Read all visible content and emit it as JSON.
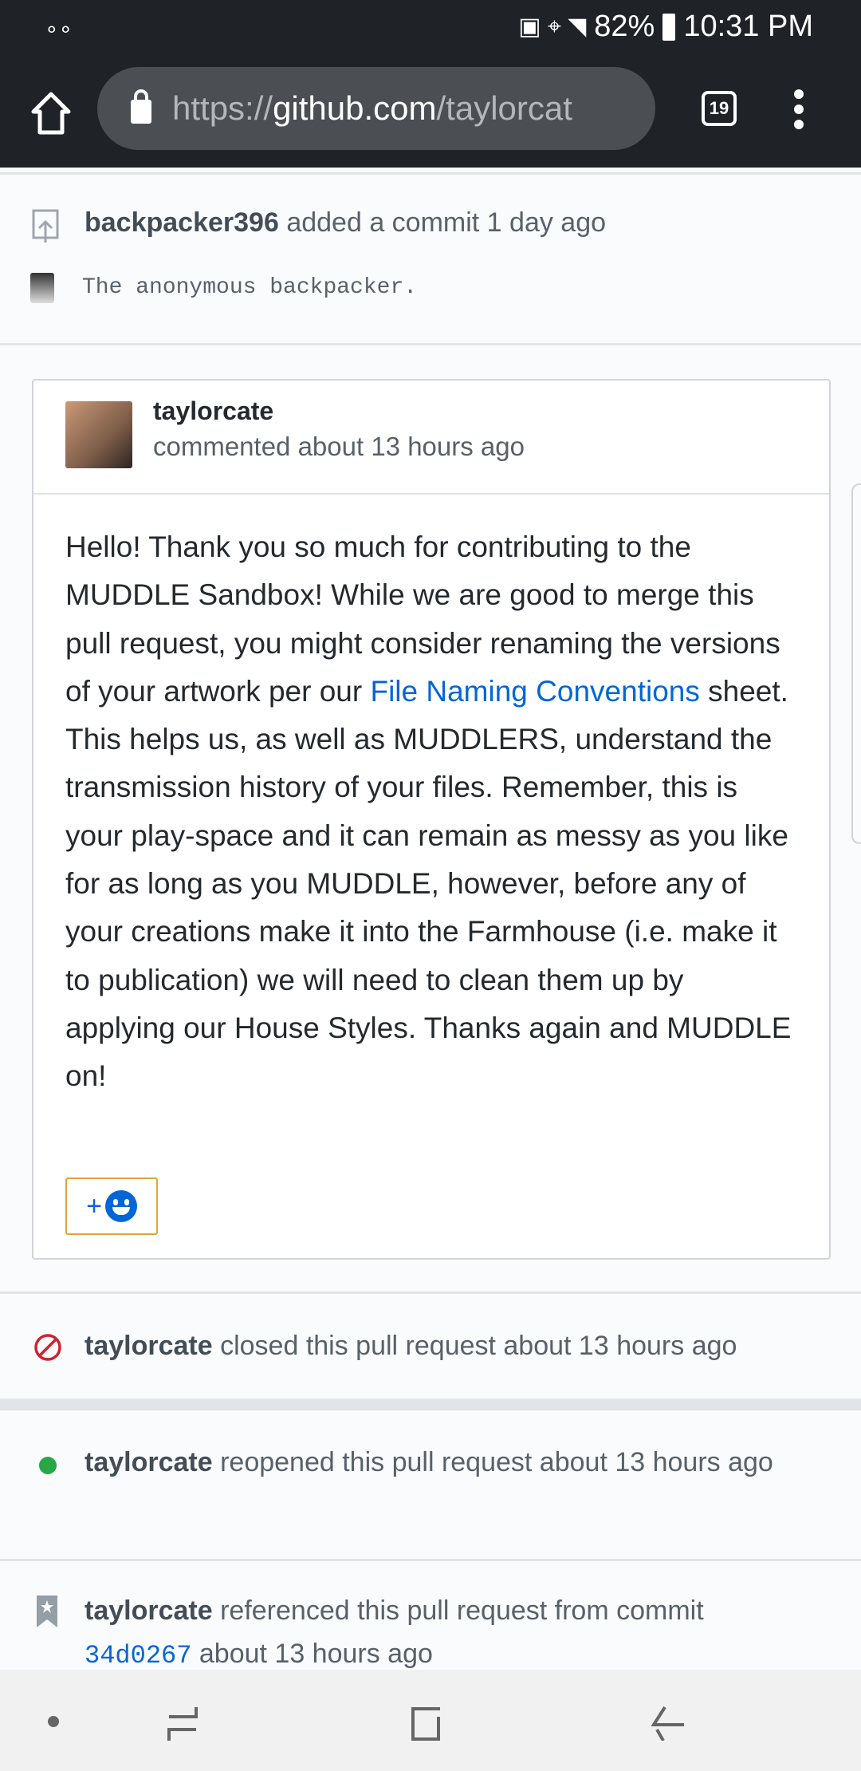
{
  "status_bar": {
    "voicemail_icon": "voicemail-icon",
    "battery_percent": "82%",
    "time": "10:31 PM"
  },
  "browser": {
    "url_prefix": "https://",
    "url_domain": "github.com",
    "url_path": "/taylorcat",
    "tab_count": "19"
  },
  "timeline": {
    "commit_event": {
      "user": "backpacker396",
      "action": "added a commit 1 day ago",
      "commit_message": "The anonymous backpacker."
    },
    "comment": {
      "author": "taylorcate",
      "meta": "commented about 13 hours ago",
      "body_before_link": "Hello! Thank you so much for contributing to the MUDDLE Sandbox! While we are good to merge this pull request, you might consider renaming the versions of your artwork per our ",
      "link": "File Naming Conventions",
      "body_after_link": " sheet. This helps us, as well as MUDDLERS, understand the transmission history of your files. Remember, this is your play-space and it can remain as messy as you like for as long as you MUDDLE, however, before any of your creations make it into the Farmhouse (i.e. make it to publication) we will need to clean them up by applying our House Styles. Thanks again and MUDDLE on!",
      "reaction_plus": "+"
    },
    "closed_event": {
      "user": "taylorcate",
      "action": "closed this pull request about 13 hours ago",
      "color": "#cb2431"
    },
    "reopened_event": {
      "user": "taylorcate",
      "action": "reopened this pull request about 13 hours ago",
      "color": "#28a745"
    },
    "referenced_event": {
      "user": "taylorcate",
      "action": "referenced this pull request from commit",
      "sha": "34d0267",
      "time": "about 13 hours ago"
    }
  }
}
